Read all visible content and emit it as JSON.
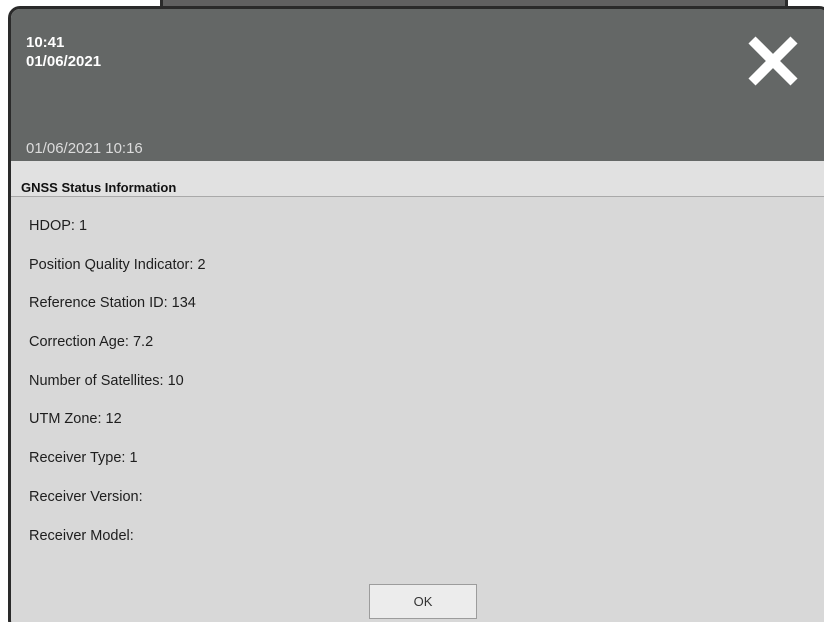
{
  "header": {
    "time": "10:41",
    "date": "01/06/2021",
    "timestamp": "01/06/2021 10:16",
    "close_icon": "close-icon"
  },
  "dialog": {
    "title": "GNSS Status Information",
    "fields": [
      "HDOP: 1",
      "Position Quality Indicator: 2",
      "Reference Station ID: 134",
      "Correction Age: 7.2",
      "Number of Satellites: 10",
      "UTM Zone: 12",
      "Receiver Type: 1",
      "Receiver Version:",
      "Receiver Model:"
    ],
    "ok_label": "OK"
  },
  "colors": {
    "header_bg": "#646766",
    "body_bg": "#d8d8d8",
    "title_bg": "#e1e1e1",
    "frame": "#2a2a2a"
  }
}
